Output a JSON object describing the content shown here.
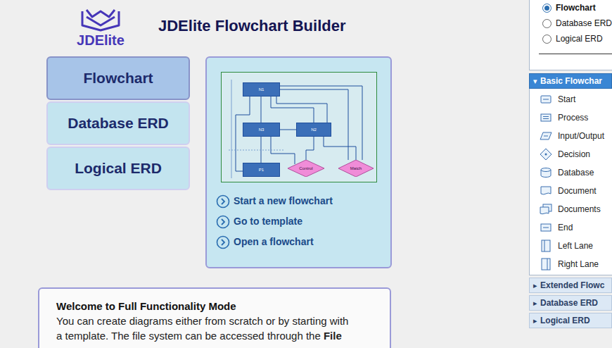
{
  "header": {
    "logo_text": "JDElite",
    "title": "JDElite Flowchart Builder"
  },
  "modes": [
    {
      "label": "Flowchart",
      "selected": true
    },
    {
      "label": "Database ERD",
      "selected": false
    },
    {
      "label": "Logical ERD",
      "selected": false
    }
  ],
  "card": {
    "preview": {
      "nodes": [
        {
          "label": "N1",
          "kind": "box"
        },
        {
          "label": "N3",
          "kind": "box"
        },
        {
          "label": "N2",
          "kind": "box"
        },
        {
          "label": "P1",
          "kind": "box"
        },
        {
          "label": "Control",
          "kind": "diamond"
        },
        {
          "label": "Match",
          "kind": "diamond"
        }
      ]
    },
    "links": [
      "Start a new flowchart",
      "Go to template",
      "Open a flowchart"
    ]
  },
  "welcome": {
    "title": "Welcome to Full Functionality Mode",
    "lines": [
      [
        {
          "text": "You can create diagrams either from scratch or by starting with",
          "bold": false
        }
      ],
      [
        {
          "text": "a template. The file system can be accessed through the ",
          "bold": false
        },
        {
          "text": "File",
          "bold": true
        }
      ]
    ]
  },
  "palette": {
    "diagram_types": [
      {
        "label": "Flowchart",
        "selected": true
      },
      {
        "label": "Database ERD",
        "selected": false
      },
      {
        "label": "Logical ERD",
        "selected": false
      }
    ],
    "sections": [
      {
        "label": "Basic Flowchar",
        "marker": "▾",
        "expanded": true,
        "items": [
          {
            "label": "Start",
            "kind": "start"
          },
          {
            "label": "Process",
            "kind": "process"
          },
          {
            "label": "Input/Output",
            "kind": "io"
          },
          {
            "label": "Decision",
            "kind": "decision"
          },
          {
            "label": "Database",
            "kind": "database"
          },
          {
            "label": "Document",
            "kind": "document"
          },
          {
            "label": "Documents",
            "kind": "documents"
          },
          {
            "label": "End",
            "kind": "end"
          },
          {
            "label": "Left Lane",
            "kind": "leftlane"
          },
          {
            "label": "Right Lane",
            "kind": "rightlane"
          }
        ]
      },
      {
        "label": "Extended Flowc",
        "marker": "▸",
        "expanded": false,
        "items": []
      },
      {
        "label": "Database ERD",
        "marker": "▸",
        "expanded": false,
        "items": []
      },
      {
        "label": "Logical ERD",
        "marker": "▸",
        "expanded": false,
        "items": []
      }
    ]
  }
}
